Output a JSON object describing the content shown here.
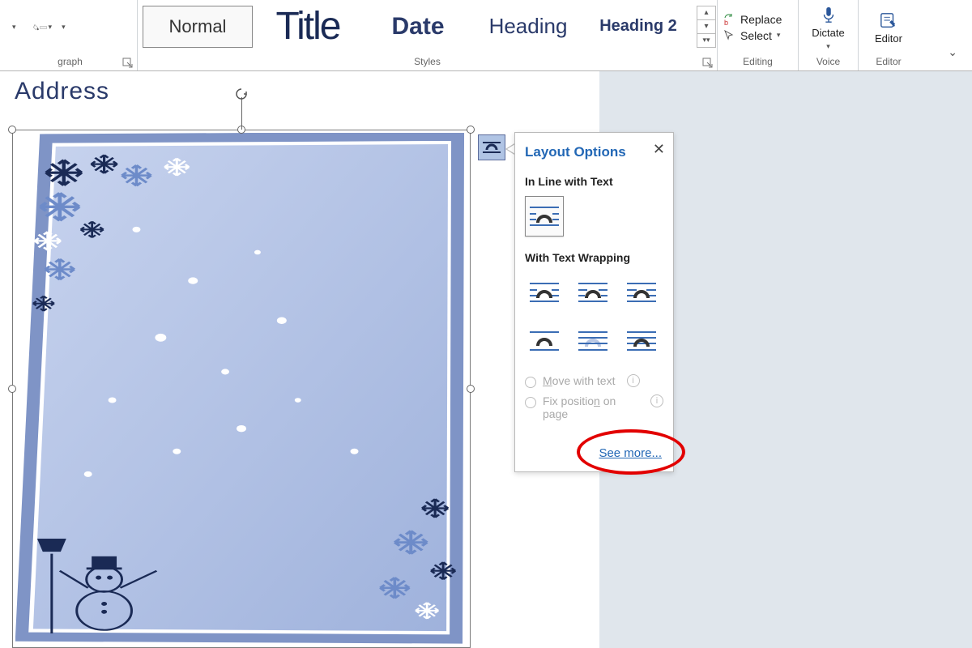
{
  "ribbon": {
    "paragraph_label": "graph",
    "line_spacing_value": "",
    "styles_label": "Styles",
    "editing_label": "Editing",
    "voice_label": "Voice",
    "editor_label": "Editor",
    "styles": {
      "normal": "Normal",
      "title": "Title",
      "date": "Date",
      "heading": "Heading",
      "heading2": "Heading 2"
    },
    "editing": {
      "replace": "Replace",
      "select": "Select"
    },
    "voice_btn": "Dictate",
    "editor_btn": "Editor"
  },
  "doc": {
    "address_label": "Address"
  },
  "flyout": {
    "title": "Layout Options",
    "inline_label": "In Line with Text",
    "wrapping_label": "With Text Wrapping",
    "move_with_text_pre": "M",
    "move_with_text_post": "ove with text",
    "fix_pos_pre": "Fix positio",
    "fix_pos_mid": "n",
    "fix_pos_post": " on page",
    "see_more": "See more..."
  }
}
